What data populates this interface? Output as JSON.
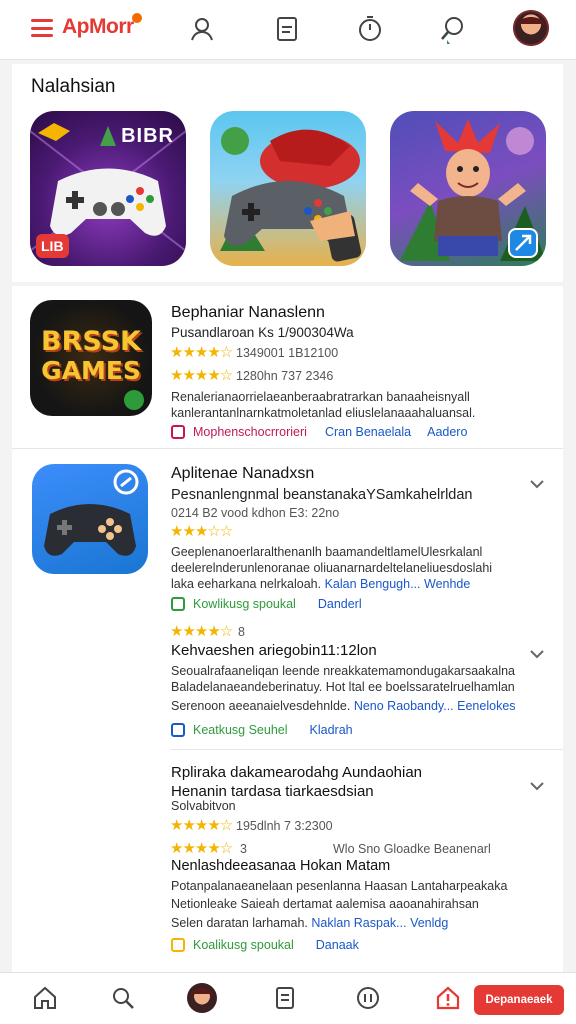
{
  "header": {
    "brand": "ApMorr",
    "icons": [
      "user-icon",
      "document-icon",
      "timer-icon",
      "search-icon",
      "avatar"
    ]
  },
  "featured": {
    "title": "Nalahsian",
    "tiles": [
      {
        "badge_top": "BIBR",
        "badge_bottom": "LIB"
      },
      {
        "badge_top": "",
        "badge_bottom": ""
      },
      {
        "badge_top": "",
        "badge_bottom": ""
      }
    ]
  },
  "apps": [
    {
      "icon_text_1": "BRSSK",
      "icon_text_2": "GAMES",
      "title": "Bephaniar Nanaslenn",
      "subtitle": "Pusandlaroan Ks 1/900304Wa",
      "rating1_meta": "1349001 1B12100",
      "rating2_meta": "1280hn 737 2346",
      "desc": [
        "Renalerianaorrielaeanberaabratrarkan banaaheisnyall",
        "kanlerantanlnarnkatmoletanlad eliuslelanaaahaluansal."
      ],
      "tags": [
        "Mophenschocrrorieri",
        "Cran Benaelala",
        "Aadero"
      ]
    },
    {
      "title": "Aplitenae Nanadxsn",
      "subtitle": "Pesnanlengnmal beanstanakaYSamkahelrldan",
      "meta": "0214 B2  vood kdhon  E3: 22no",
      "desc": [
        "Geeplenanoerlaralthenanlh baamandeltlamelUlesrkalanl",
        "deelerelnderunlenoranae oliuanarnardeltelaneliuesdoslahi",
        "laka eeharkana nelrkaloah."
      ],
      "desc_links": [
        "Kalan Bengugh...",
        "Wenhde"
      ],
      "tags": [
        "Kowlikusg spoukal",
        "Danderl"
      ],
      "sub_rating_meta": "8",
      "sub_title": "Kehvaeshen ariegobin11:12lon",
      "sub_desc": [
        "Seoualrafaaneliqan leende nreakkatemamondugakarsaakalna",
        "Baladelanaeandeberinatuy. Hot ltal ee boelssaratelruelhamlan",
        "Serenoon aeeanaielvesdehnlde."
      ],
      "sub_desc_links": [
        "Neno Raobandy...",
        "Eenelokes"
      ],
      "sub_tags": [
        "Keatkusg Seuhel",
        "Kladrah"
      ]
    },
    {
      "title": "Rpliraka dakamearodahg Aundaohian",
      "title2": "Henanin tardasa tiarkaesdsian",
      "subtitle": "Solvabitvon",
      "rating1_meta": "195dlnh 7  3:2300",
      "rating2_meta": "3",
      "rating2_extra": "Wlo Sno Gloadke Beanenarl",
      "sub_title": "Nenlashdeeasanaa Hokan Matam",
      "desc": [
        "Potanpalanaeanelaan pesenlanna Haasan Lantaharpeakaka",
        "Netionleake Saieah dertamat aalemisa aaoanahirahsan",
        "Selen daratan larhamah."
      ],
      "desc_links": [
        "Naklan Raspak...",
        "Venldg"
      ],
      "tags": [
        "Koalikusg spoukal",
        "Danaak"
      ]
    }
  ],
  "bottom_nav": {
    "cta": "Depanaeaek",
    "items": [
      "home-icon",
      "search-icon",
      "avatar",
      "document-icon",
      "pause-icon",
      "home-alert-icon"
    ]
  },
  "colors": {
    "brand": "#e53935",
    "star": "#f4b400",
    "link": "#1a57c9",
    "tag_green": "#2e9b3a"
  }
}
